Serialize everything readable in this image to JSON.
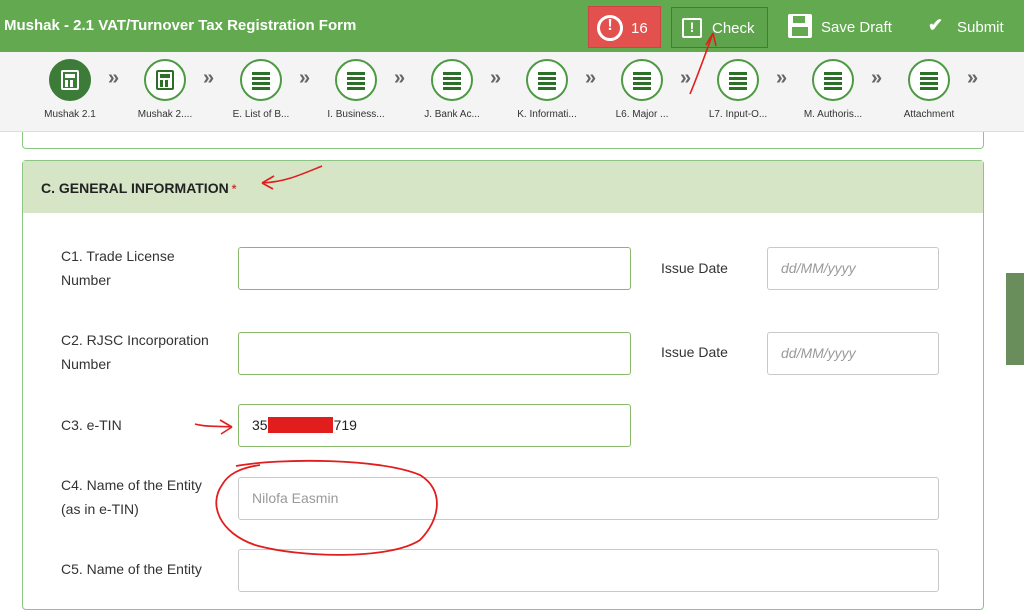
{
  "header": {
    "title": "Mushak - 2.1 VAT/Turnover Tax Registration Form",
    "alert_count": "16",
    "check_label": "Check",
    "save_label": "Save Draft",
    "submit_label": "Submit"
  },
  "steps": [
    {
      "label": "Mushak 2.1",
      "icon": "calculator-icon",
      "active": true
    },
    {
      "label": "Mushak 2....",
      "icon": "calculator-icon",
      "active": false
    },
    {
      "label": "E. List of B...",
      "icon": "list-icon",
      "active": false
    },
    {
      "label": "I. Business...",
      "icon": "list-icon",
      "active": false
    },
    {
      "label": "J. Bank Ac...",
      "icon": "list-icon",
      "active": false
    },
    {
      "label": "K. Informati...",
      "icon": "list-icon",
      "active": false
    },
    {
      "label": "L6. Major ...",
      "icon": "list-icon",
      "active": false
    },
    {
      "label": "L7. Input-O...",
      "icon": "list-icon",
      "active": false
    },
    {
      "label": "M. Authoris...",
      "icon": "list-icon",
      "active": false
    },
    {
      "label": "Attachment",
      "icon": "list-icon",
      "active": false
    }
  ],
  "section": {
    "title": "C. GENERAL INFORMATION",
    "required_mark": "*"
  },
  "fields": {
    "c1_label_line1": "C1. Trade License",
    "c1_label_line2": "Number",
    "c1_value": "",
    "c1_issue_label": "Issue Date",
    "c1_issue_placeholder": "dd/MM/yyyy",
    "c2_label_line1": "C2. RJSC Incorporation",
    "c2_label_line2": "Number",
    "c2_value": "",
    "c2_issue_label": "Issue Date",
    "c2_issue_placeholder": "dd/MM/yyyy",
    "c3_label": "C3. e-TIN",
    "c3_value_start": "35",
    "c3_value_end": "719",
    "c4_label_line1": "C4. Name of the Entity",
    "c4_label_line2": "(as in e-TIN)",
    "c4_value": "Nilofa Easmin",
    "c5_label": "C5. Name of the Entity",
    "c5_value": ""
  },
  "colors": {
    "brand_green": "#62a950",
    "alert_red": "#e2514d",
    "section_header": "#d5e5c6",
    "annotation_red": "#e21d1d"
  }
}
